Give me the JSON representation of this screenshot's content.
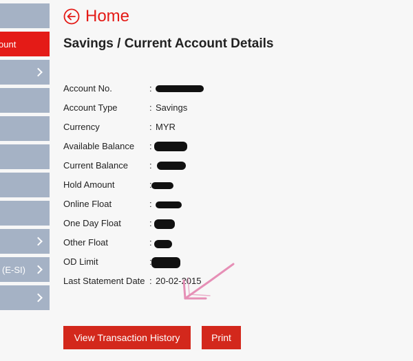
{
  "sidebar": {
    "items": [
      {
        "label": "",
        "chevron": false
      },
      {
        "label": "ount",
        "chevron": false,
        "active": true
      },
      {
        "label": "",
        "chevron": true
      },
      {
        "label": "",
        "chevron": false
      },
      {
        "label": "",
        "chevron": false
      },
      {
        "label": "",
        "chevron": false
      },
      {
        "label": "",
        "chevron": false
      },
      {
        "label": "",
        "chevron": false
      },
      {
        "label": "",
        "chevron": true
      },
      {
        "label": "(E-SI)",
        "chevron": true
      },
      {
        "label": "",
        "chevron": true
      }
    ]
  },
  "header": {
    "home_label": "Home",
    "title": "Savings / Current Account Details"
  },
  "details": {
    "rows": [
      {
        "label": "Account No.",
        "value": ""
      },
      {
        "label": "Account Type",
        "value": "Savings"
      },
      {
        "label": "Currency",
        "value": "MYR"
      },
      {
        "label": "Available Balance",
        "value": ""
      },
      {
        "label": "Current Balance",
        "value": ""
      },
      {
        "label": "Hold Amount",
        "value": ""
      },
      {
        "label": "Online Float",
        "value": ""
      },
      {
        "label": "One Day Float",
        "value": ""
      },
      {
        "label": "Other Float",
        "value": ""
      },
      {
        "label": "OD Limit",
        "value": ""
      },
      {
        "label": "Last Statement Date",
        "value": "20-02-2015"
      }
    ],
    "separator": ":"
  },
  "actions": {
    "view_history_label": "View Transaction History",
    "print_label": "Print"
  },
  "colors": {
    "accent": "#e41b17",
    "button": "#d3281c",
    "sidebar": "#a5b2c5",
    "annotation": "#e68fb6"
  }
}
